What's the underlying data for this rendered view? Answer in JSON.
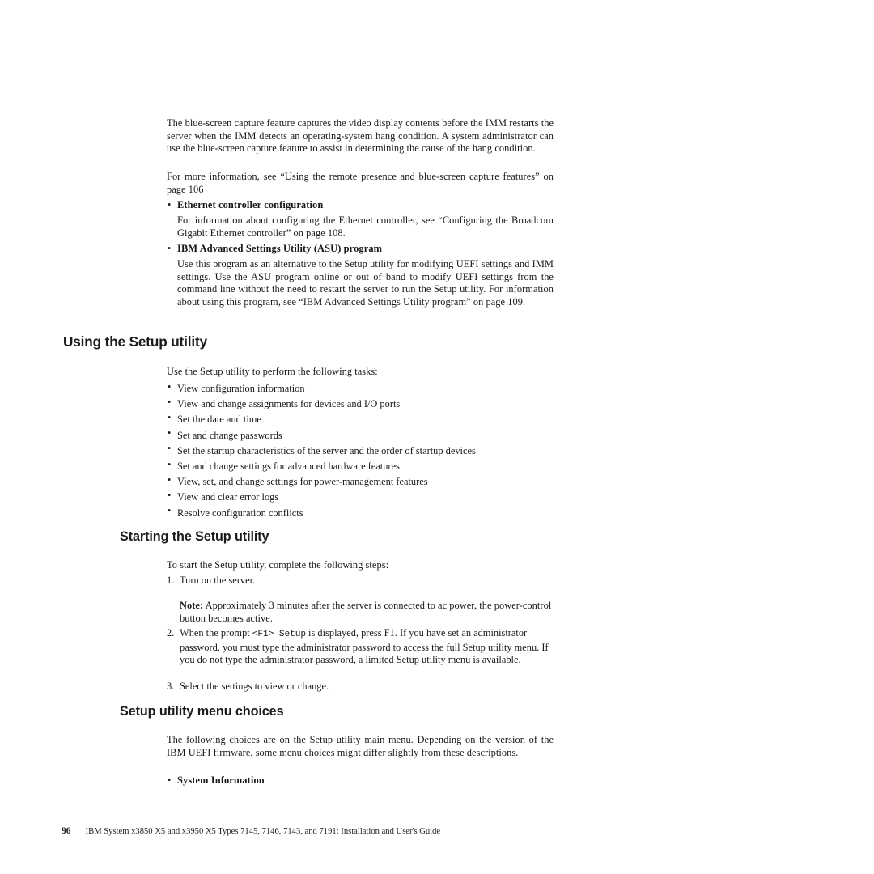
{
  "document": {
    "page_number": "96",
    "footer_text": "IBM System x3850 X5 and x3950 X5 Types 7145, 7146, 7143, and 7191: Installation and User's Guide"
  },
  "intro": {
    "para1": "The blue-screen capture feature captures the video display contents before the IMM restarts the server when the IMM detects an operating-system hang condition. A system administrator can use the blue-screen capture feature to assist in determining the cause of the hang condition.",
    "para2": "For more information, see “Using the remote presence and blue-screen capture features” on page 106",
    "bullets": [
      {
        "term": "Ethernet controller configuration",
        "body": "For information about configuring the Ethernet controller, see “Configuring the Broadcom Gigabit Ethernet controller” on page 108."
      },
      {
        "term": "IBM Advanced Settings Utility (ASU) program",
        "body": "Use this program as an alternative to the Setup utility for modifying UEFI settings and IMM settings. Use the ASU program online or out of band to modify UEFI settings from the command line without the need to restart the server to run the Setup utility. For information about using this program, see “IBM Advanced Settings Utility program” on page 109."
      }
    ]
  },
  "section_using": {
    "heading": "Using the Setup utility",
    "intro": "Use the Setup utility to perform the following tasks:",
    "tasks": [
      "View configuration information",
      "View and change assignments for devices and I/O ports",
      "Set the date and time",
      "Set and change passwords",
      "Set the startup characteristics of the server and the order of startup devices",
      "Set and change settings for advanced hardware features",
      "View, set, and change settings for power-management features",
      "View and clear error logs",
      "Resolve configuration conflicts"
    ]
  },
  "section_starting": {
    "heading": "Starting the Setup utility",
    "intro": "To start the Setup utility, complete the following steps:",
    "step1": {
      "marker": "1.",
      "text": "Turn on the server."
    },
    "note": {
      "label": "Note:",
      "text": "Approximately 3 minutes after the server is connected to ac power, the power-control button becomes active."
    },
    "step2": {
      "marker": "2.",
      "text_before": "When the prompt ",
      "mono": "<F1> Setup",
      "text_after": " is displayed, press F1. If you have set an administrator password, you must type the administrator password to access the full Setup utility menu. If you do not type the administrator password, a limited Setup utility menu is available."
    },
    "step3": {
      "marker": "3.",
      "text": "Select the settings to view or change."
    }
  },
  "section_menu": {
    "heading": "Setup utility menu choices",
    "intro": "The following choices are on the Setup utility main menu. Depending on the version of the IBM UEFI firmware, some menu choices might differ slightly from these descriptions.",
    "items": [
      {
        "term": "System Information"
      }
    ]
  },
  "glyphs": {
    "bullet": "•"
  }
}
